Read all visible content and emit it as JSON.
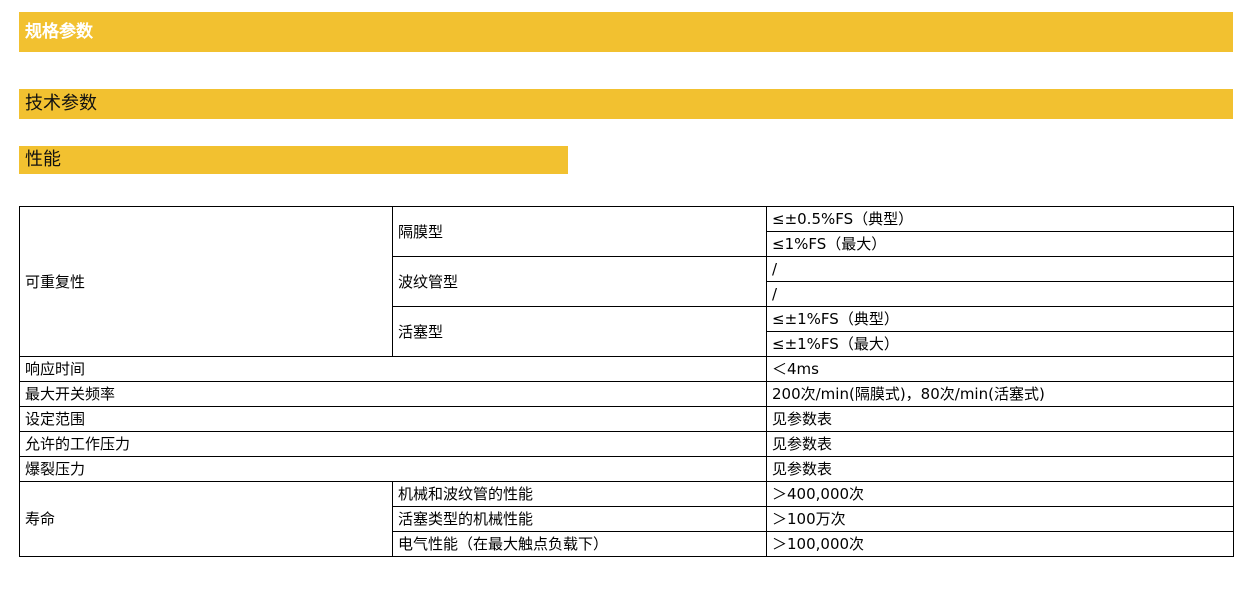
{
  "headers": {
    "spec_params": "规格参数",
    "tech_params": "技术参数",
    "performance": "性能"
  },
  "table": {
    "repeatability": {
      "label": "可重复性",
      "diaphragm": {
        "label": "隔膜型",
        "values": [
          "≤±0.5%FS（典型）",
          "≤1%FS（最大）"
        ]
      },
      "bellows": {
        "label": "波纹管型",
        "values": [
          "/",
          "/"
        ]
      },
      "piston": {
        "label": "活塞型",
        "values": [
          "≤±1%FS（典型）",
          "≤±1%FS（最大）"
        ]
      }
    },
    "rows": [
      {
        "label": "响应时间",
        "value": "＜4ms"
      },
      {
        "label": "最大开关频率",
        "value": "200次/min(隔膜式)，80次/min(活塞式)"
      },
      {
        "label": "设定范围",
        "value": "见参数表"
      },
      {
        "label": "允许的工作压力",
        "value": "见参数表"
      },
      {
        "label": "爆裂压力",
        "value": "见参数表"
      }
    ],
    "life": {
      "label": "寿命",
      "items": [
        {
          "label": "机械和波纹管的性能",
          "value": "＞400,000次"
        },
        {
          "label": "活塞类型的机械性能",
          "value": "＞100万次"
        },
        {
          "label": "电气性能（在最大触点负载下）",
          "value": "＞100,000次"
        }
      ]
    }
  },
  "colors": {
    "band": "#f2c130",
    "border": "#000000"
  }
}
